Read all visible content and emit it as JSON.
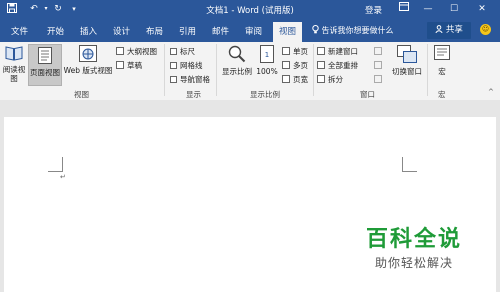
{
  "titlebar": {
    "title": "文档1 - Word (试用版)",
    "login": "登录",
    "restore_icon": "ribbon-display-icon",
    "minimize": "—",
    "maximize": "☐",
    "close": "✕"
  },
  "tabs": [
    "文件",
    "开始",
    "插入",
    "设计",
    "布局",
    "引用",
    "邮件",
    "审阅",
    "视图"
  ],
  "active_tab": "视图",
  "tell_me": "告诉我你想要做什么",
  "share": "共享",
  "ribbon": {
    "views": {
      "label": "视图",
      "read_mode": "阅读视图",
      "print_layout": "页面视图",
      "web_layout": "Web 版式视图",
      "outline": "大纲视图",
      "draft": "草稿"
    },
    "show": {
      "label": "显示",
      "ruler": "标尺",
      "gridlines": "网格线",
      "nav_pane": "导航窗格"
    },
    "zoom": {
      "label": "显示比例",
      "zoom": "显示比例",
      "hundred": "100%",
      "one_page": "单页",
      "multi_page": "多页",
      "page_width": "页宽"
    },
    "window": {
      "label": "窗口",
      "new_window": "新建窗口",
      "arrange_all": "全部重排",
      "split": "拆分",
      "switch_windows": "切换窗口"
    },
    "macros": {
      "label": "宏",
      "macros": "宏"
    }
  },
  "document": {
    "paragraph_mark": "↵"
  },
  "watermark": {
    "title": "百科全说",
    "subtitle": "助你轻松解决"
  },
  "colors": {
    "brand": "#2b579a",
    "ribbon": "#f3f3f3",
    "watermark_green": "#1f9b38"
  }
}
